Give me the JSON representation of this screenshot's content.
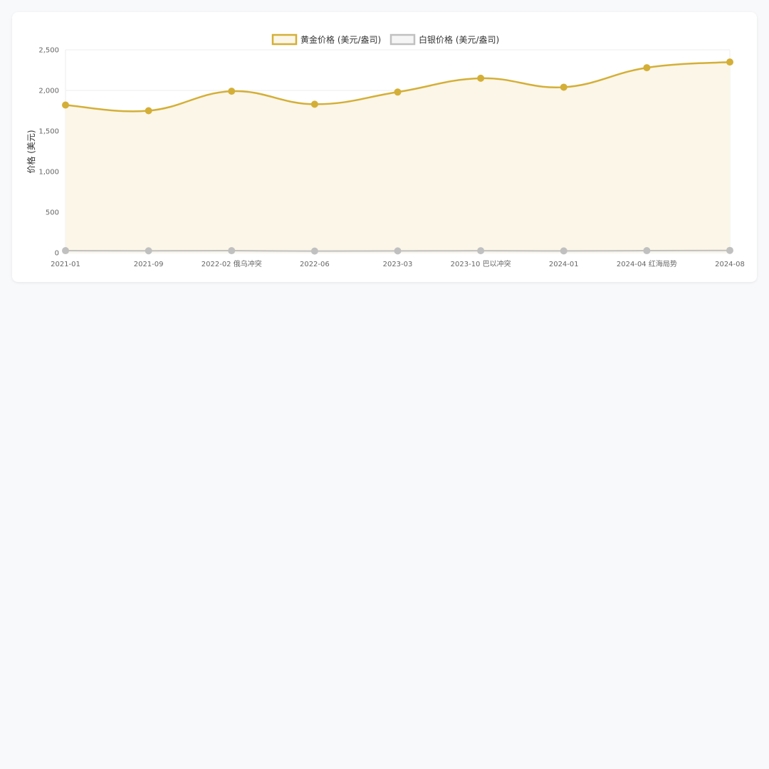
{
  "chart_data": {
    "type": "area",
    "categories": [
      "2021-01",
      "2021-09",
      "2022-02 俄乌冲突",
      "2022-06",
      "2023-03",
      "2023-10 巴以冲突",
      "2024-01",
      "2024-04 红海局势",
      "2024-08"
    ],
    "series": [
      {
        "name": "黄金价格 (美元/盎司)",
        "values": [
          1820,
          1750,
          1990,
          1830,
          1980,
          2150,
          2040,
          2280,
          2350
        ],
        "color": "#d4af37",
        "fill": "#fbf6e8"
      },
      {
        "name": "白银价格 (美元/盎司)",
        "values": [
          26,
          24,
          26,
          21,
          23,
          25,
          23,
          26,
          29
        ],
        "color": "#c0c0c0"
      }
    ],
    "ylabel": "价格 (美元)",
    "ylim": [
      0,
      2500
    ],
    "yticks": [
      0,
      500,
      1000,
      1500,
      2000,
      2500
    ],
    "grid": true,
    "legend": "top-center"
  }
}
